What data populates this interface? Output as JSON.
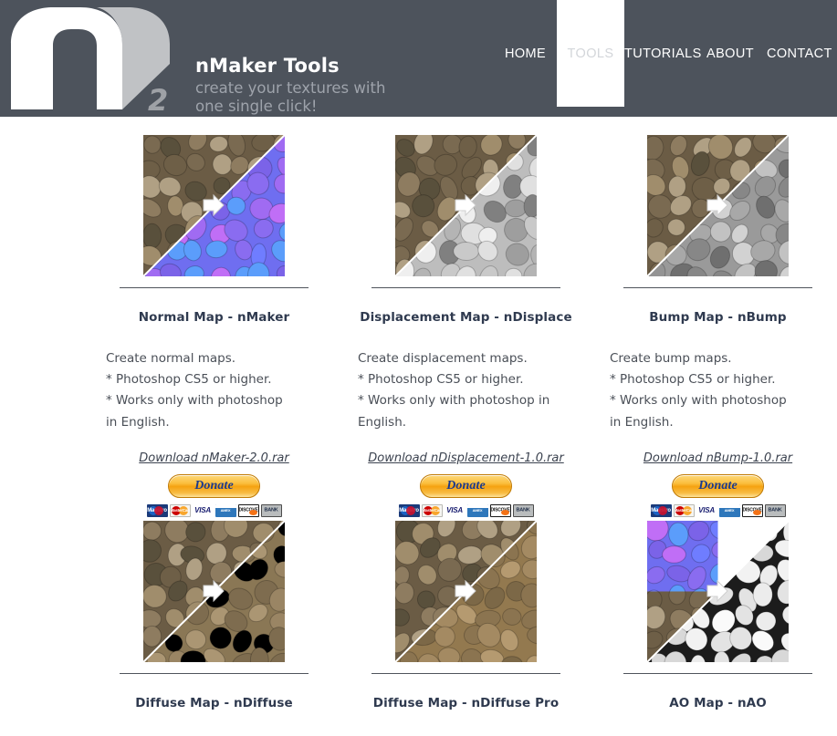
{
  "header": {
    "logo_name": "nmaker-logo",
    "logo_superscript": "2",
    "brand_title": "nMaker Tools",
    "brand_sub_line1": "create your textures with",
    "brand_sub_line2": "one single click!",
    "bg_color": "#4d535c",
    "nav": [
      {
        "id": "home",
        "label": "HOME",
        "active": false
      },
      {
        "id": "tools",
        "label": "TOOLS",
        "active": true
      },
      {
        "id": "tutorials",
        "label": "TUTORIALS",
        "active": false
      },
      {
        "id": "about",
        "label": "ABOUT",
        "active": false
      },
      {
        "id": "contact",
        "label": "CONTACT",
        "active": false
      }
    ]
  },
  "donate": {
    "label": "Donate",
    "accent_color": "#f5a210",
    "text_color": "#1a3a8f",
    "payment_methods": [
      {
        "id": "maestro",
        "label": "Maestro"
      },
      {
        "id": "mastercard",
        "label": "MasterCard"
      },
      {
        "id": "visa",
        "label": "VISA"
      },
      {
        "id": "amex",
        "label": "AMERICAN EXPRESS"
      },
      {
        "id": "discover",
        "label": "DISCOVER"
      },
      {
        "id": "bank",
        "label": "BANK"
      }
    ]
  },
  "cards": [
    {
      "id": "nmaker",
      "thumb_name": "normal-map-preview",
      "thumb_kind": "normal",
      "title": "Normal Map - nMaker",
      "desc_lines": [
        "Create normal maps.",
        "* Photoshop CS5 or higher.",
        "* Works only with photoshop",
        "in English."
      ],
      "download_label": "Download nMaker-2.0.rar"
    },
    {
      "id": "ndisplace",
      "thumb_name": "displacement-map-preview",
      "thumb_kind": "displacement",
      "title": "Displacement Map - nDisplace",
      "desc_lines": [
        "Create displacement maps.",
        "* Photoshop CS5 or higher.",
        "* Works only with photoshop in",
        "English."
      ],
      "download_label": "Download nDisplacement-1.0.rar"
    },
    {
      "id": "nbump",
      "thumb_name": "bump-map-preview",
      "thumb_kind": "bump",
      "title": "Bump Map - nBump",
      "desc_lines": [
        "Create bump maps.",
        "* Photoshop CS5 or higher.",
        "* Works only with photoshop",
        "in English."
      ],
      "download_label": "Download nBump-1.0.rar"
    },
    {
      "id": "ndiffuse",
      "thumb_name": "diffuse-map-preview",
      "thumb_kind": "diffuse",
      "title": "Diffuse Map - nDiffuse",
      "desc_lines": [],
      "download_label": ""
    },
    {
      "id": "ndiffusepro",
      "thumb_name": "diffuse-map-pro-preview",
      "thumb_kind": "diffusepro",
      "title": "Diffuse Map - nDiffuse Pro",
      "desc_lines": [],
      "download_label": ""
    },
    {
      "id": "nao",
      "thumb_name": "ao-map-preview",
      "thumb_kind": "ao",
      "title": "AO Map - nAO",
      "desc_lines": [],
      "download_label": ""
    }
  ]
}
